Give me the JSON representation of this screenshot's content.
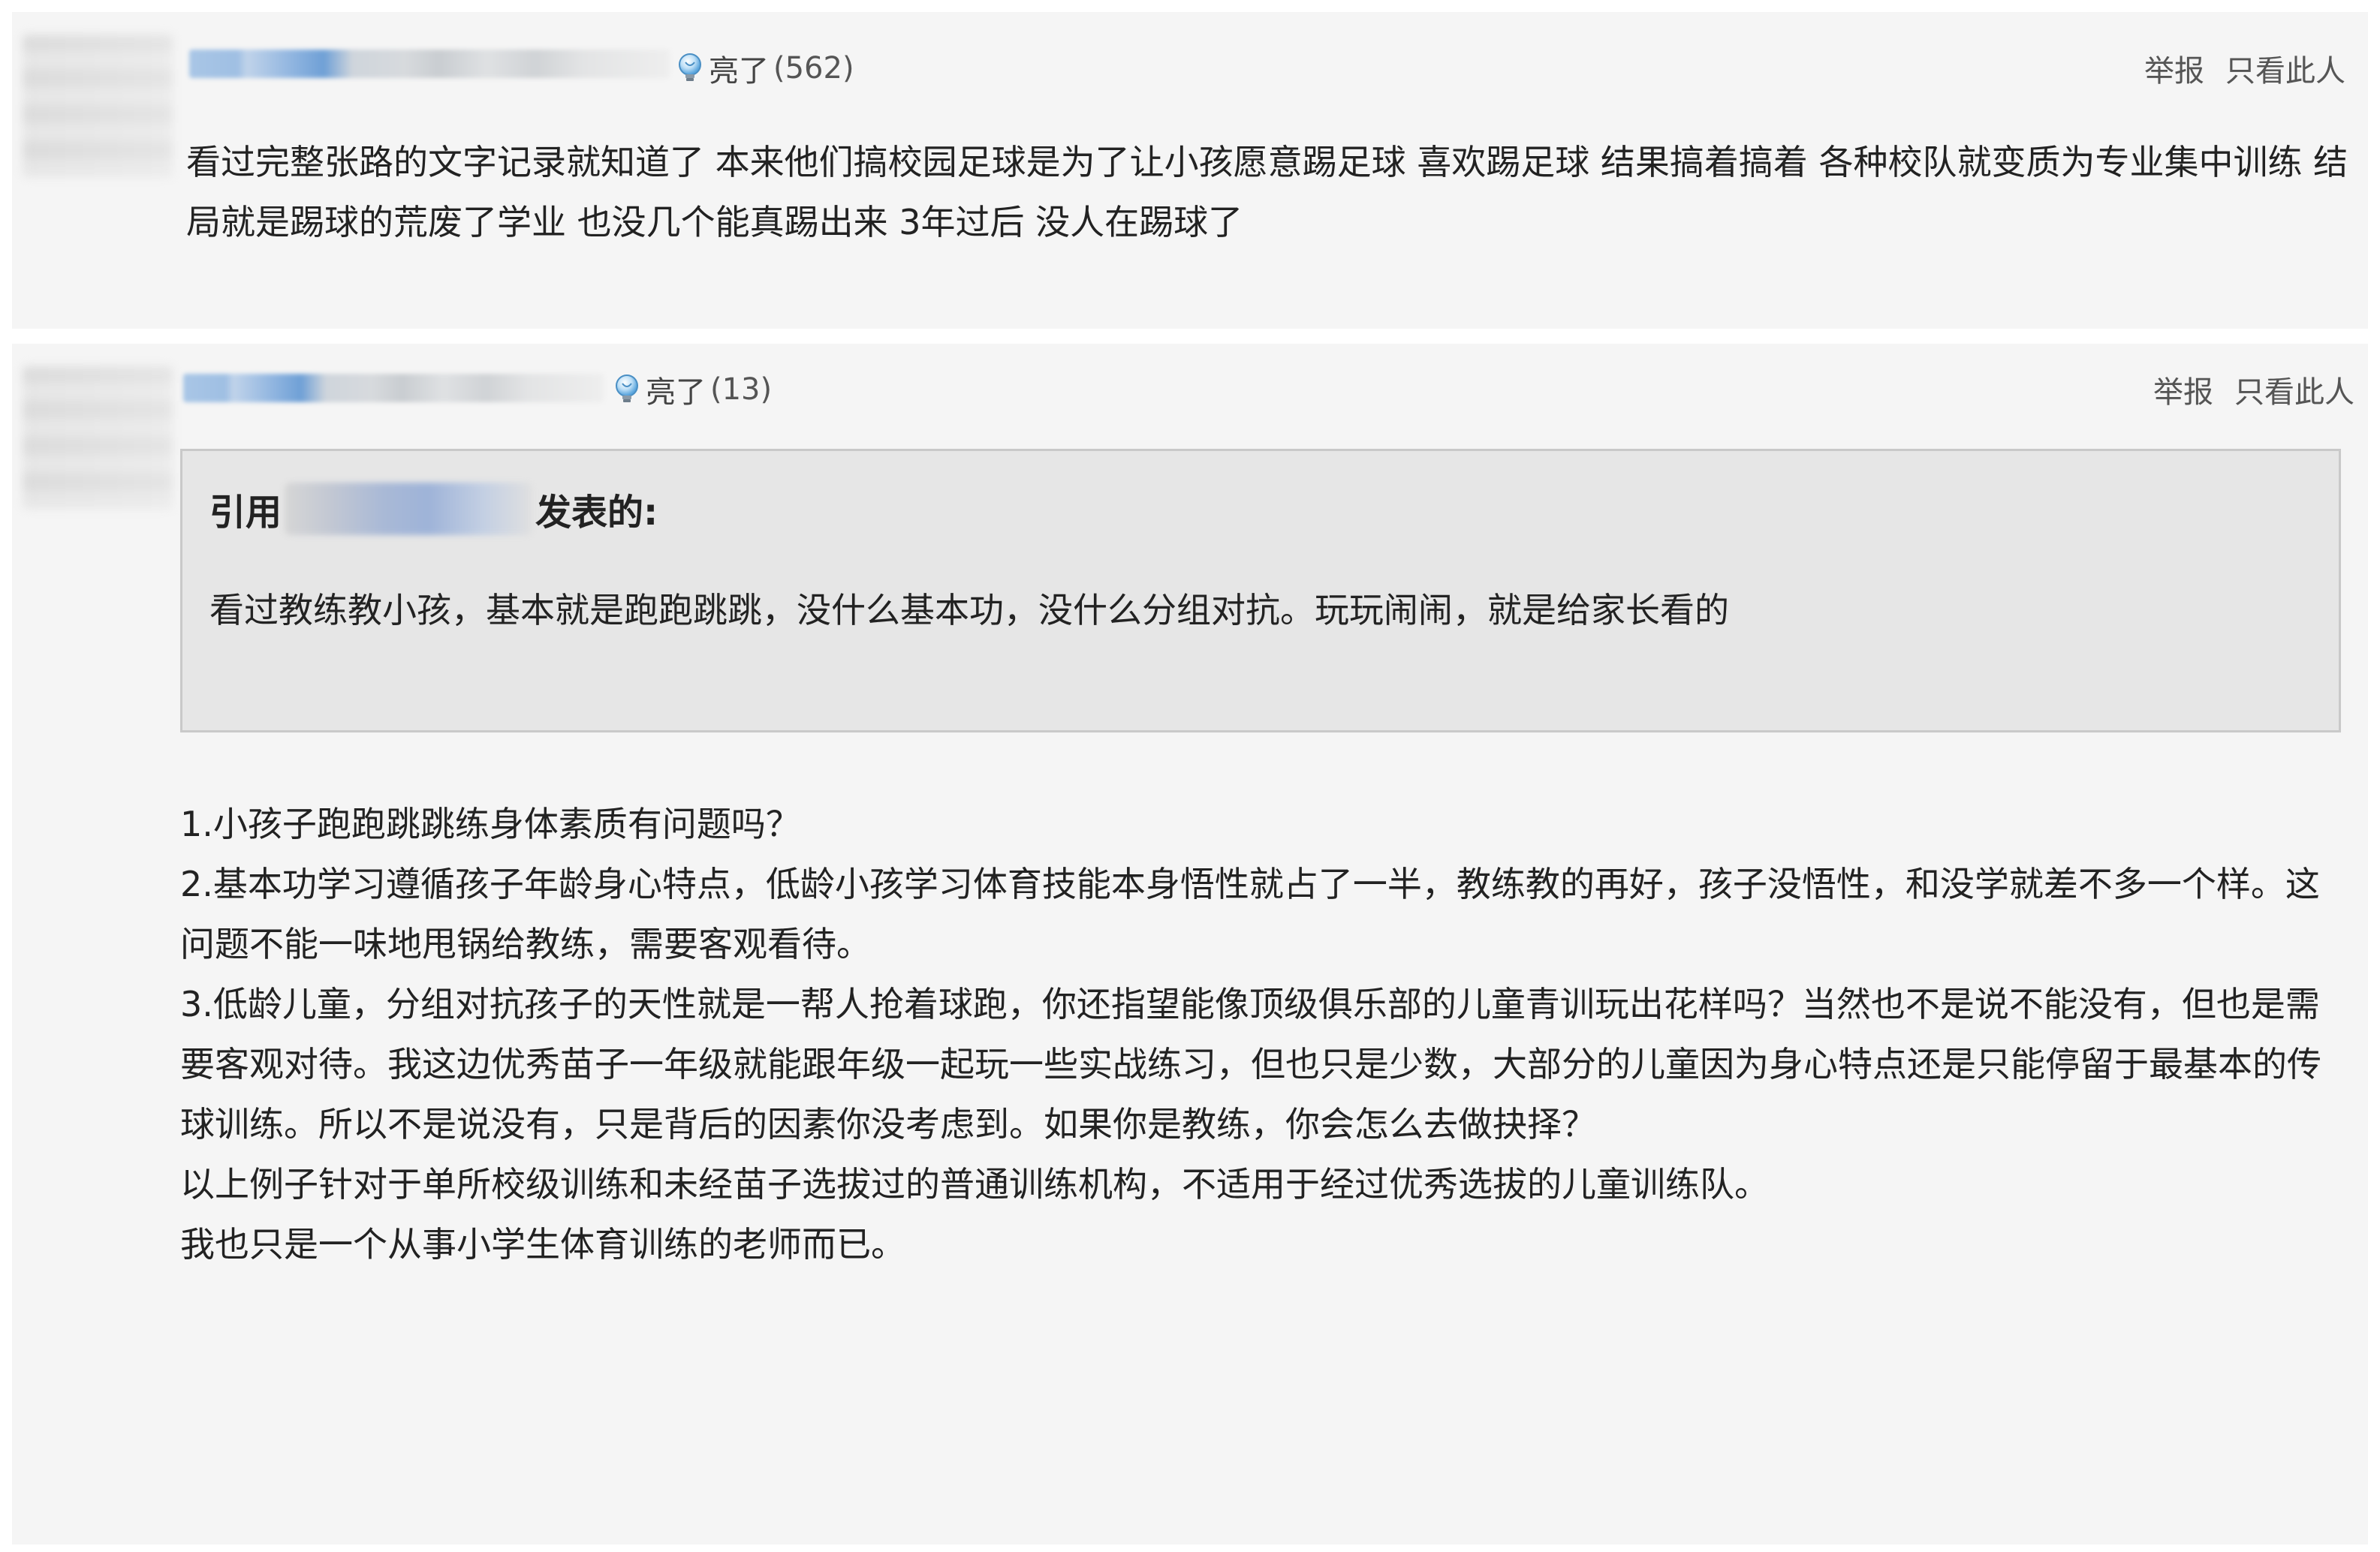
{
  "posts": [
    {
      "light_label": "亮了",
      "light_count": "(562)",
      "report_label": "举报",
      "only_this_label": "只看此人",
      "content": "看过完整张路的文字记录就知道了 本来他们搞校园足球是为了让小孩愿意踢足球 喜欢踢足球 结果搞着搞着 各种校队就变质为专业集中训练 结局就是踢球的荒废了学业 也没几个能真踢出来 3年过后 没人在踢球了"
    },
    {
      "light_label": "亮了",
      "light_count": "(13)",
      "report_label": "举报",
      "only_this_label": "只看此人",
      "quote": {
        "prefix": "引用",
        "suffix": "发表的:",
        "text": "看过教练教小孩，基本就是跑跑跳跳，没什么基本功，没什么分组对抗。玩玩闹闹，就是给家长看的"
      },
      "paragraphs": [
        "1.小孩子跑跑跳跳练身体素质有问题吗？",
        "2.基本功学习遵循孩子年龄身心特点，低龄小孩学习体育技能本身悟性就占了一半，教练教的再好，孩子没悟性，和没学就差不多一个样。这问题不能一味地甩锅给教练，需要客观看待。",
        "3.低龄儿童，分组对抗孩子的天性就是一帮人抢着球跑，你还指望能像顶级俱乐部的儿童青训玩出花样吗？当然也不是说不能没有，但也是需要客观对待。我这边优秀苗子一年级就能跟年级一起玩一些实战练习，但也只是少数，大部分的儿童因为身心特点还是只能停留于最基本的传球训练。所以不是说没有，只是背后的因素你没考虑到。如果你是教练，你会怎么去做抉择？",
        "以上例子针对于单所校级训练和未经苗子选拔过的普通训练机构，不适用于经过优秀选拔的儿童训练队。",
        "我也只是一个从事小学生体育训练的老师而已。"
      ]
    }
  ],
  "colors": {
    "post_bg": "#f5f5f5",
    "quote_bg": "#e6e6e6",
    "quote_border": "#c9c9c9",
    "text": "#222222",
    "muted": "#555555"
  }
}
